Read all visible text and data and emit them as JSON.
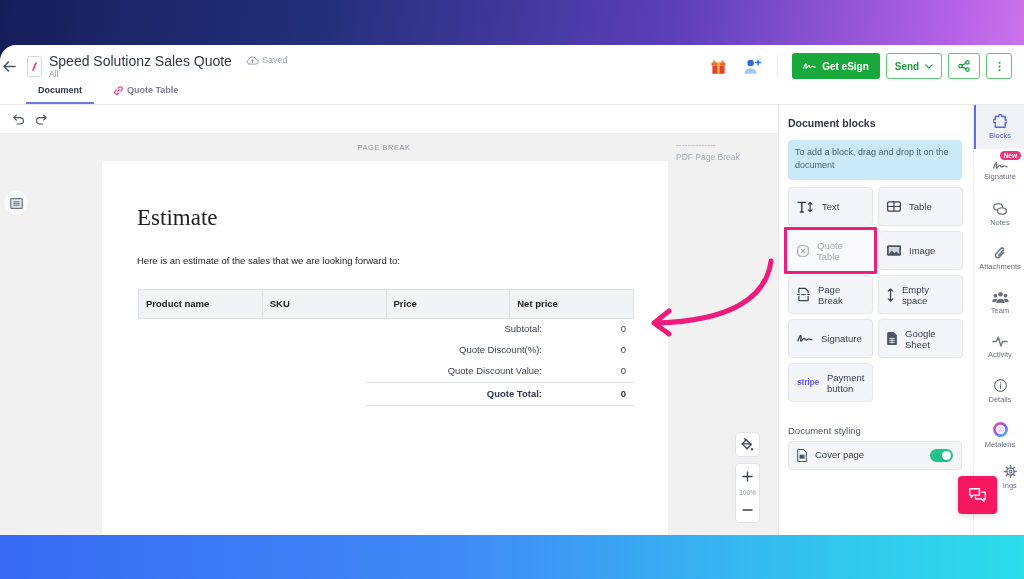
{
  "header": {
    "title": "Speed Solutionz Sales Quote",
    "save_status": "Saved",
    "folder": "All"
  },
  "tabs": [
    {
      "label": "Document",
      "linked": false,
      "selected": true
    },
    {
      "label": "Quote Table",
      "linked": true,
      "selected": false
    }
  ],
  "actions": {
    "esign": "Get eSign",
    "send": "Send"
  },
  "canvas": {
    "page_break": "PAGE BREAK",
    "break_marker": [
      "--------------",
      "PDF Page Break"
    ],
    "zoom": "100%"
  },
  "document": {
    "heading": "Estimate",
    "intro": "Here is an estimate of the sales that we are looking forward to:",
    "columns": [
      "Product name",
      "SKU",
      "Price",
      "Net price"
    ],
    "summary": [
      {
        "label": "Subtotal:",
        "value": "0",
        "total": false
      },
      {
        "label": "Quote Discount(%):",
        "value": "0",
        "total": false
      },
      {
        "label": "Quote Discount Value:",
        "value": "0",
        "total": false
      },
      {
        "label": "Quote Total:",
        "value": "0",
        "total": true
      }
    ]
  },
  "panel": {
    "title": "Document blocks",
    "hint": "To add a block, drag and drop it on the document",
    "blocks": [
      {
        "label": "Text",
        "kind": "text",
        "disabled": false,
        "highlighted": false
      },
      {
        "label": "Table",
        "kind": "table",
        "disabled": false,
        "highlighted": false
      },
      {
        "label": "Quote Table",
        "kind": "quote",
        "disabled": true,
        "highlighted": true
      },
      {
        "label": "Image",
        "kind": "image",
        "disabled": false,
        "highlighted": false
      },
      {
        "label": "Page Break",
        "kind": "page_break",
        "disabled": false,
        "highlighted": false
      },
      {
        "label": "Empty space",
        "kind": "spacer",
        "disabled": false,
        "highlighted": false
      },
      {
        "label": "Signature",
        "kind": "signature",
        "disabled": false,
        "highlighted": false
      },
      {
        "label": "Google Sheet",
        "kind": "sheet",
        "disabled": false,
        "highlighted": false
      },
      {
        "label": "Payment button",
        "kind": "payment",
        "logo": "stripe",
        "disabled": false,
        "highlighted": false
      }
    ],
    "styling_title": "Document styling",
    "styling": [
      {
        "label": "Cover page",
        "on": true
      }
    ]
  },
  "rail": [
    {
      "label": "Blocks",
      "kind": "blocks",
      "selected": true
    },
    {
      "label": "Signature",
      "kind": "signature",
      "badge": "New",
      "selected": false
    },
    {
      "label": "Notes",
      "kind": "notes",
      "selected": false
    },
    {
      "label": "Attachments",
      "kind": "attachments",
      "selected": false
    },
    {
      "label": "Team",
      "kind": "team",
      "selected": false
    },
    {
      "label": "Activity",
      "kind": "activity",
      "selected": false
    },
    {
      "label": "Details",
      "kind": "details",
      "selected": false
    },
    {
      "label": "Metalens",
      "kind": "metalens",
      "selected": false
    },
    {
      "label": "ings",
      "kind": "settings",
      "selected": false
    }
  ]
}
